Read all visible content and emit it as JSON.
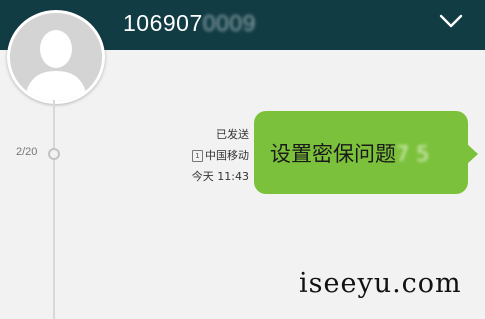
{
  "header": {
    "contact_number": "106907",
    "contact_number_masked": "0009",
    "expand_icon": "chevron-down-icon",
    "background_color": "#123c44"
  },
  "avatar": {
    "icon": "default-person-avatar"
  },
  "timeline": {
    "page_counter": "2/20"
  },
  "message": {
    "status": "已发送",
    "sim_slot": "1",
    "carrier": "中国移动",
    "timestamp": "今天 11:43",
    "text": "设置密保问题",
    "text_masked": "7  5",
    "bubble_color": "#7cc13b"
  },
  "watermark": "iseeyu.com"
}
